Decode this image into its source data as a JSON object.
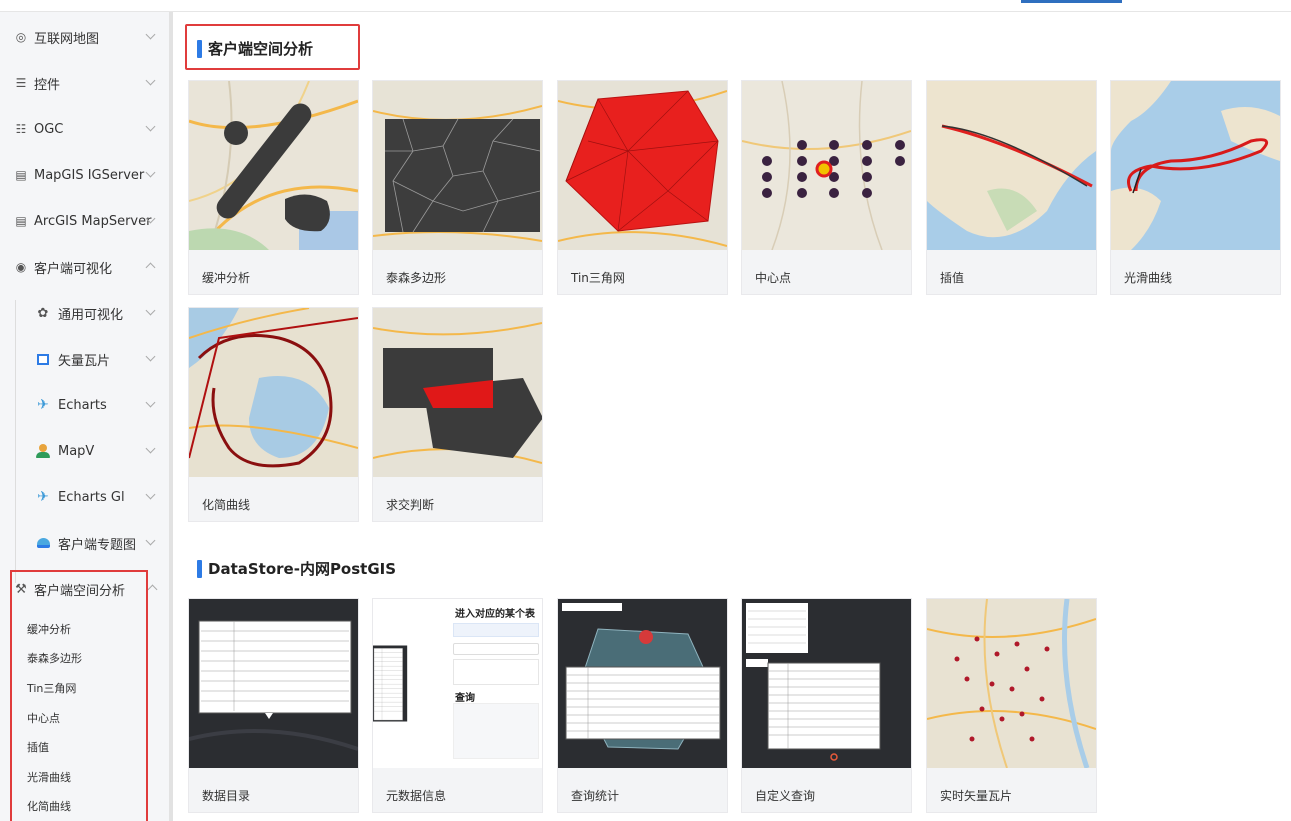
{
  "sidebar": {
    "items": [
      {
        "label": "互联网地图",
        "icon": "globe-icon",
        "expanded": false
      },
      {
        "label": "控件",
        "icon": "sliders-icon",
        "expanded": false
      },
      {
        "label": "OGC",
        "icon": "list-icon",
        "expanded": false
      },
      {
        "label": "MapGIS IGServer",
        "icon": "server-icon",
        "expanded": false
      },
      {
        "label": "ArcGIS MapServer",
        "icon": "server-icon",
        "expanded": false
      },
      {
        "label": "客户端可视化",
        "icon": "eye-icon",
        "expanded": true
      }
    ],
    "visual_sub": [
      {
        "label": "通用可视化",
        "icon": "cluster-icon"
      },
      {
        "label": "矢量瓦片",
        "icon": "tile-icon"
      },
      {
        "label": "Echarts",
        "icon": "echarts-icon"
      },
      {
        "label": "MapV",
        "icon": "mapv-icon"
      },
      {
        "label": "Echarts Gl",
        "icon": "echarts-gl-icon"
      },
      {
        "label": "客户端专题图",
        "icon": "theme-map-icon"
      }
    ],
    "analysis": {
      "label": "客户端空间分析",
      "icon": "tool-icon",
      "expanded": true
    },
    "analysis_leaves": [
      "缓冲分析",
      "泰森多边形",
      "Tin三角网",
      "中心点",
      "插值",
      "光滑曲线",
      "化简曲线"
    ]
  },
  "section1": {
    "title": "客户端空间分析",
    "cards": [
      "缓冲分析",
      "泰森多边形",
      "Tin三角网",
      "中心点",
      "插值",
      "光滑曲线",
      "化简曲线",
      "求交判断"
    ]
  },
  "section2": {
    "title": "DataStore-内网PostGIS",
    "cards": [
      "数据目录",
      "元数据信息",
      "查询统计",
      "自定义查询",
      "实时矢量瓦片"
    ],
    "meta_heading": "进入对应的某个表",
    "meta_query": "查询"
  },
  "colors": {
    "accent": "#2d7be5",
    "highlight": "#e03c3c"
  }
}
